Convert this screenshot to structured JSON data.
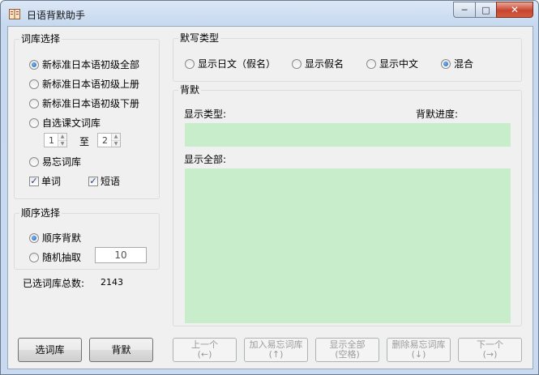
{
  "window": {
    "title": "日语背默助手"
  },
  "library": {
    "title": "词库选择",
    "options": [
      {
        "label": "新标准日本语初级全部",
        "selected": true
      },
      {
        "label": "新标准日本语初级上册",
        "selected": false
      },
      {
        "label": "新标准日本语初级下册",
        "selected": false
      },
      {
        "label": "自选课文词库",
        "selected": false
      },
      {
        "label": "易忘词库",
        "selected": false
      }
    ],
    "range_from": "1",
    "range_sep": "至",
    "range_to": "2",
    "words_label": "单词",
    "phrases_label": "短语"
  },
  "order": {
    "title": "顺序选择",
    "sequential": "顺序背默",
    "random": "随机抽取",
    "random_count": "10"
  },
  "total": {
    "label": "已选词库总数:",
    "value": "2143"
  },
  "dictation": {
    "title": "默写类型",
    "options": [
      {
        "label": "显示日文（假名）",
        "selected": false
      },
      {
        "label": "显示假名",
        "selected": false
      },
      {
        "label": "显示中文",
        "selected": false
      },
      {
        "label": "混合",
        "selected": true
      }
    ]
  },
  "recite": {
    "title": "背默",
    "type_label": "显示类型:",
    "progress_label": "背默进度:",
    "all_label": "显示全部:"
  },
  "buttons": {
    "choose": "选词库",
    "recite": "背默",
    "prev_1": "上一个",
    "prev_2": "(←)",
    "add_1": "加入易忘词库",
    "add_2": "(↑)",
    "show_1": "显示全部",
    "show_2": "(空格)",
    "remove_1": "删除易忘词库",
    "remove_2": "(↓)",
    "next_1": "下一个",
    "next_2": "(→)"
  }
}
